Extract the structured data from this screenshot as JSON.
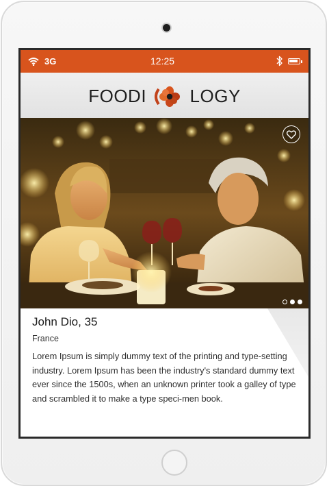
{
  "status_bar": {
    "network": "3G",
    "time": "12:25",
    "battery_level": 0.9,
    "wifi_icon": "wifi-icon",
    "bluetooth_icon": "bluetooth-icon",
    "battery_icon": "battery-icon"
  },
  "app": {
    "logo_left": "FOODI",
    "logo_right": "LOGY",
    "brand_color": "#d8541d"
  },
  "photo": {
    "favorite_icon": "heart-outline-icon",
    "carousel_total": 3,
    "carousel_active": 1
  },
  "profile": {
    "name": "John Dio, 35",
    "country": "France",
    "bio": "Lorem Ipsum is simply dummy text of the printing and type-setting industry. Lorem Ipsum has been the industry's standard dummy text ever since the 1500s, when an unknown printer took a galley of type and scrambled it to make a type speci-men book."
  }
}
